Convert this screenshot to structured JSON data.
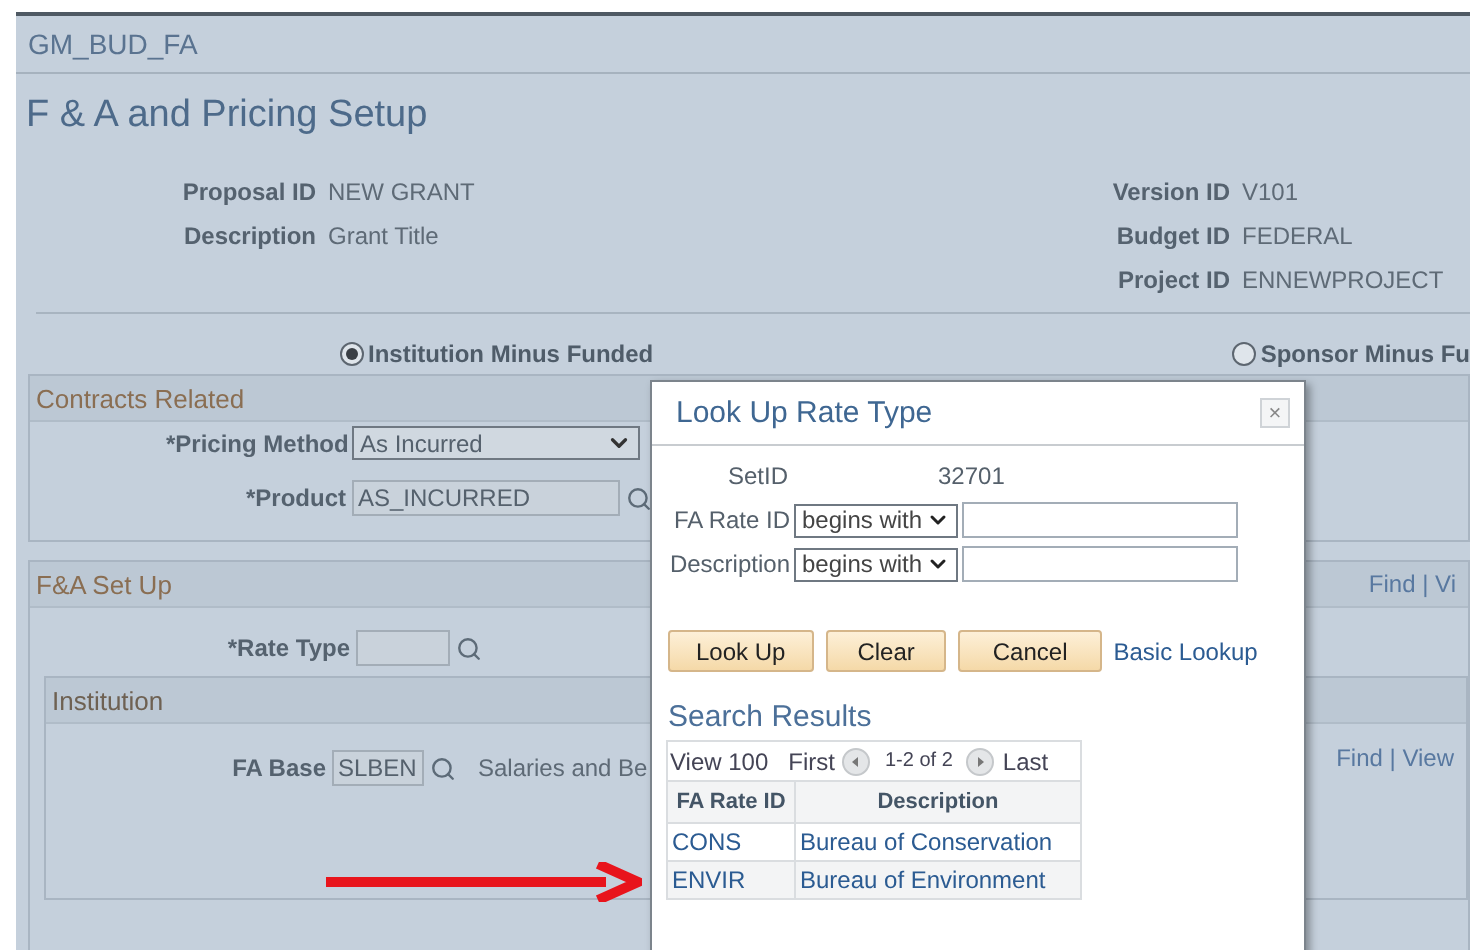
{
  "page": {
    "component": "GM_BUD_FA",
    "title": "F & A and Pricing Setup"
  },
  "header_left": [
    {
      "label": "Proposal ID",
      "value": "NEW GRANT"
    },
    {
      "label": "Description",
      "value": "Grant Title"
    }
  ],
  "header_right": [
    {
      "label": "Version ID",
      "value": "V101"
    },
    {
      "label": "Budget ID",
      "value": "FEDERAL"
    },
    {
      "label": "Project ID",
      "value": "ENNEWPROJECT"
    }
  ],
  "radios": [
    {
      "label": "Institution Minus Funded",
      "selected": true
    },
    {
      "label": "Sponsor Minus Fu",
      "selected": false
    }
  ],
  "contracts": {
    "title": "Contracts Related",
    "pricing_method": {
      "label": "*Pricing Method",
      "value": "As Incurred"
    },
    "product": {
      "label": "*Product",
      "value": "AS_INCURRED"
    }
  },
  "fa_setup": {
    "title": "F&A Set Up",
    "grid_links": "Find | Vi",
    "rate_type": {
      "label": "*Rate Type"
    },
    "institution": {
      "title": "Institution",
      "grid_links": "Find | View",
      "fa_base": {
        "label": "FA Base",
        "value": "SLBEN",
        "description": "Salaries and Be"
      }
    }
  },
  "modal": {
    "title": "Look Up Rate Type",
    "close": "×",
    "setid": {
      "label": "SetID",
      "value": "32701"
    },
    "criteria": [
      {
        "label": "FA Rate ID",
        "operator": "begins with"
      },
      {
        "label": "Description",
        "operator": "begins with"
      }
    ],
    "buttons": [
      "Look Up",
      "Clear",
      "Cancel"
    ],
    "basic_lookup": "Basic Lookup",
    "results_title": "Search Results",
    "nav": {
      "view": "View 100",
      "first": "First",
      "range": "1-2 of 2",
      "last": "Last"
    },
    "columns": [
      "FA Rate ID",
      "Description"
    ],
    "rows": [
      [
        "CONS",
        "Bureau of Conservation"
      ],
      [
        "ENVIR",
        "Bureau of Environment"
      ]
    ]
  }
}
